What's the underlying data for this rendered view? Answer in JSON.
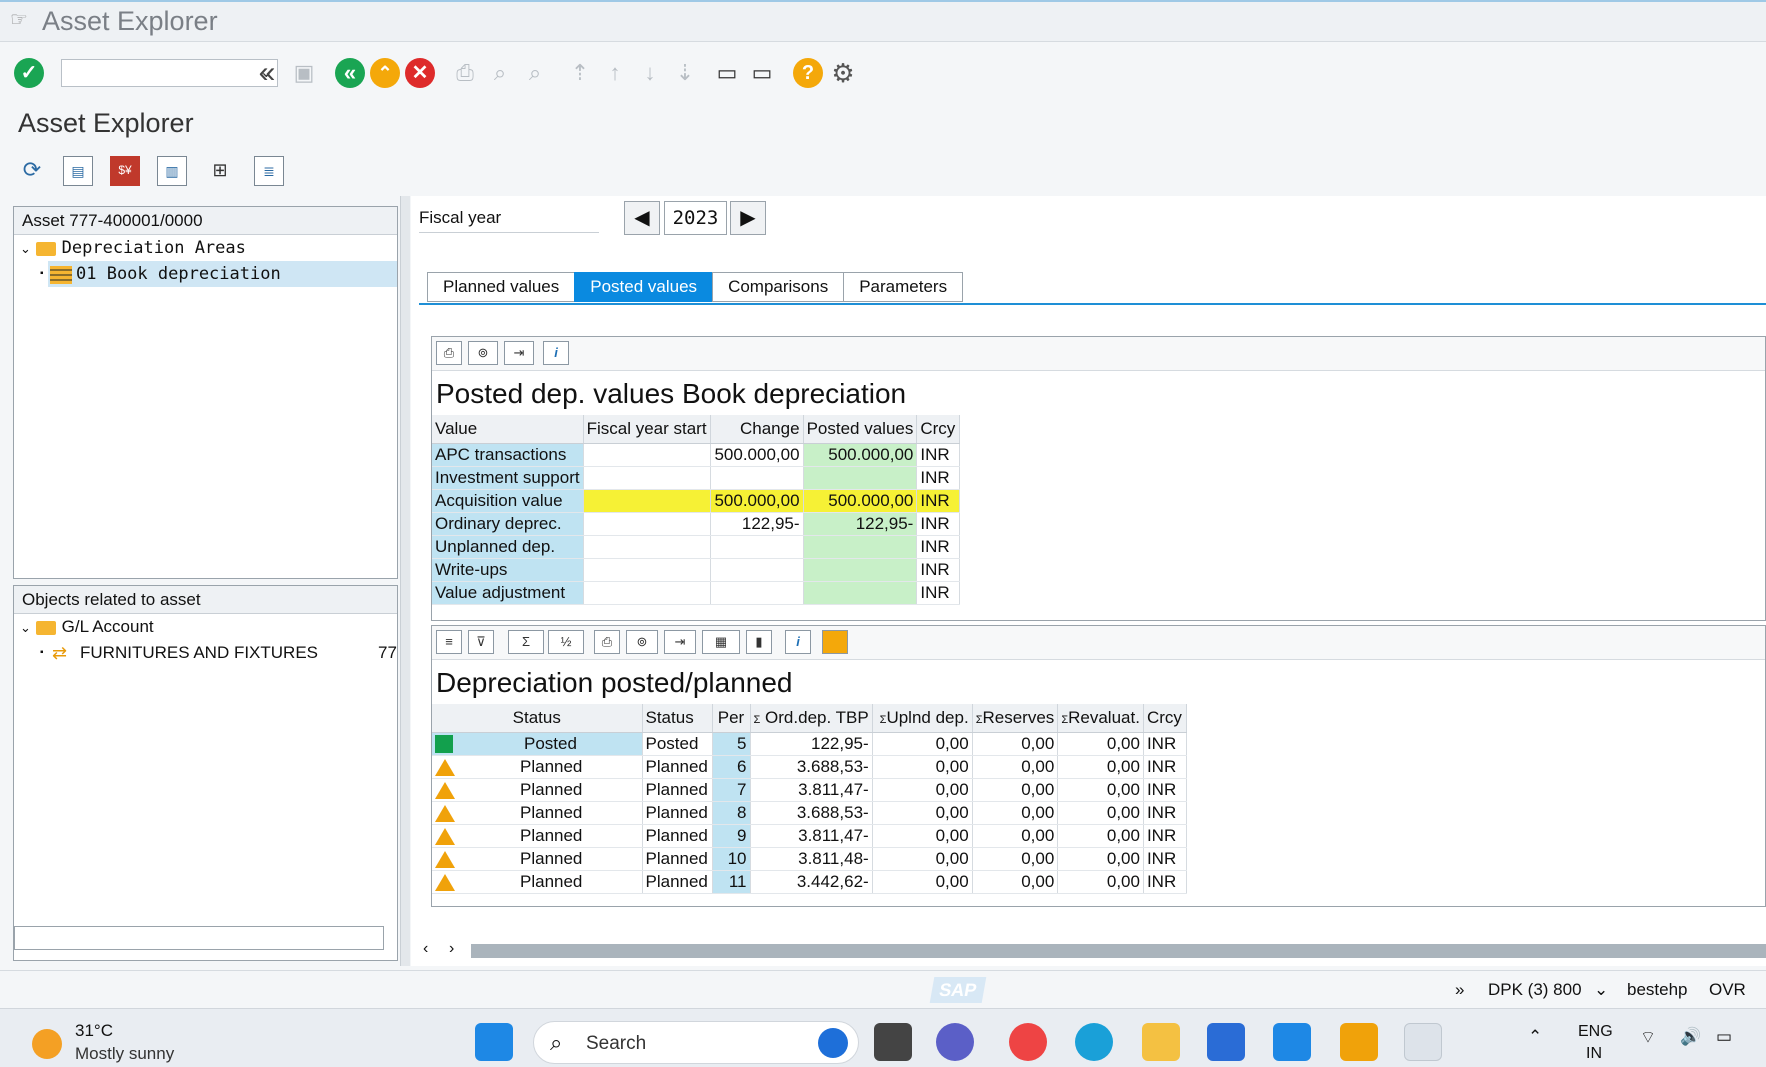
{
  "window": {
    "title": "Asset Explorer"
  },
  "page": {
    "title": "Asset Explorer"
  },
  "toolbar": {
    "command_value": "",
    "icons": [
      "enter-check-icon",
      "back-double-icon",
      "save-icon",
      "back-icon",
      "exit-icon",
      "cancel-icon",
      "print-icon",
      "find-icon",
      "find-next-icon",
      "first-page-icon",
      "prev-page-icon",
      "next-page-icon",
      "last-page-icon",
      "new-session-icon",
      "shortcut-icon",
      "help-icon",
      "settings-gear-icon"
    ]
  },
  "left_top": {
    "header": "Asset 777-400001/0000",
    "folder": "Depreciation Areas",
    "item": "01 Book depreciation"
  },
  "left_bottom": {
    "header": "Objects related to asset",
    "folder": "G/L Account",
    "item": "FURNITURES AND FIXTURES",
    "item_extra": "77"
  },
  "fiscal_year": {
    "label": "Fiscal year",
    "value": "2023"
  },
  "tabs": [
    "Planned values",
    "Posted values",
    "Comparisons",
    "Parameters"
  ],
  "active_tab": "Posted values",
  "posted": {
    "title": "Posted dep. values Book depreciation",
    "headers": [
      "Value",
      "Fiscal year start",
      "Change",
      "Posted values",
      "Crcy"
    ],
    "rows": [
      {
        "value": "APC transactions",
        "start": "",
        "change": "500.000,00",
        "posted": "500.000,00",
        "crcy": "INR"
      },
      {
        "value": "Investment support",
        "start": "",
        "change": "",
        "posted": "",
        "crcy": "INR"
      },
      {
        "value": "Acquisition value",
        "start": "",
        "change": "500.000,00",
        "posted": "500.000,00",
        "crcy": "INR"
      },
      {
        "value": "Ordinary deprec.",
        "start": "",
        "change": "122,95-",
        "posted": "122,95-",
        "crcy": "INR"
      },
      {
        "value": "Unplanned dep.",
        "start": "",
        "change": "",
        "posted": "",
        "crcy": "INR"
      },
      {
        "value": "Write-ups",
        "start": "",
        "change": "",
        "posted": "",
        "crcy": "INR"
      },
      {
        "value": "Value adjustment",
        "start": "",
        "change": "",
        "posted": "",
        "crcy": "INR"
      }
    ]
  },
  "depreciation": {
    "title": "Depreciation posted/planned",
    "headers": [
      "Status",
      "Status",
      "Per",
      "Ord.dep. TBP",
      "Uplnd dep.",
      "Reserves",
      "Revaluat.",
      "Crcy"
    ],
    "rows": [
      {
        "icon": "posted",
        "status1": "Posted",
        "status2": "Posted",
        "per": "5",
        "ord": "122,95-",
        "unpl": "0,00",
        "res": "0,00",
        "reval": "0,00",
        "crcy": "INR"
      },
      {
        "icon": "planned",
        "status1": "Planned",
        "status2": "Planned",
        "per": "6",
        "ord": "3.688,53-",
        "unpl": "0,00",
        "res": "0,00",
        "reval": "0,00",
        "crcy": "INR"
      },
      {
        "icon": "planned",
        "status1": "Planned",
        "status2": "Planned",
        "per": "7",
        "ord": "3.811,47-",
        "unpl": "0,00",
        "res": "0,00",
        "reval": "0,00",
        "crcy": "INR"
      },
      {
        "icon": "planned",
        "status1": "Planned",
        "status2": "Planned",
        "per": "8",
        "ord": "3.688,53-",
        "unpl": "0,00",
        "res": "0,00",
        "reval": "0,00",
        "crcy": "INR"
      },
      {
        "icon": "planned",
        "status1": "Planned",
        "status2": "Planned",
        "per": "9",
        "ord": "3.811,47-",
        "unpl": "0,00",
        "res": "0,00",
        "reval": "0,00",
        "crcy": "INR"
      },
      {
        "icon": "planned",
        "status1": "Planned",
        "status2": "Planned",
        "per": "10",
        "ord": "3.811,48-",
        "unpl": "0,00",
        "res": "0,00",
        "reval": "0,00",
        "crcy": "INR"
      },
      {
        "icon": "planned",
        "status1": "Planned",
        "status2": "Planned",
        "per": "11",
        "ord": "3.442,62-",
        "unpl": "0,00",
        "res": "0,00",
        "reval": "0,00",
        "crcy": "INR"
      }
    ]
  },
  "statusbar": {
    "logo": "SAP",
    "system": "DPK (3) 800",
    "user": "bestehp",
    "mode": "OVR"
  },
  "taskbar": {
    "temperature": "31°C",
    "weather": "Mostly sunny",
    "search_placeholder": "Search",
    "lang": "ENG",
    "region": "IN"
  },
  "colors": {
    "active_tab": "#0a8ae0",
    "key_col": "#bfe3f2",
    "green_col": "#c8f0c8",
    "highlight": "#f6f135",
    "posted_status": "#12a04d",
    "planned_status": "#f0a20a"
  }
}
